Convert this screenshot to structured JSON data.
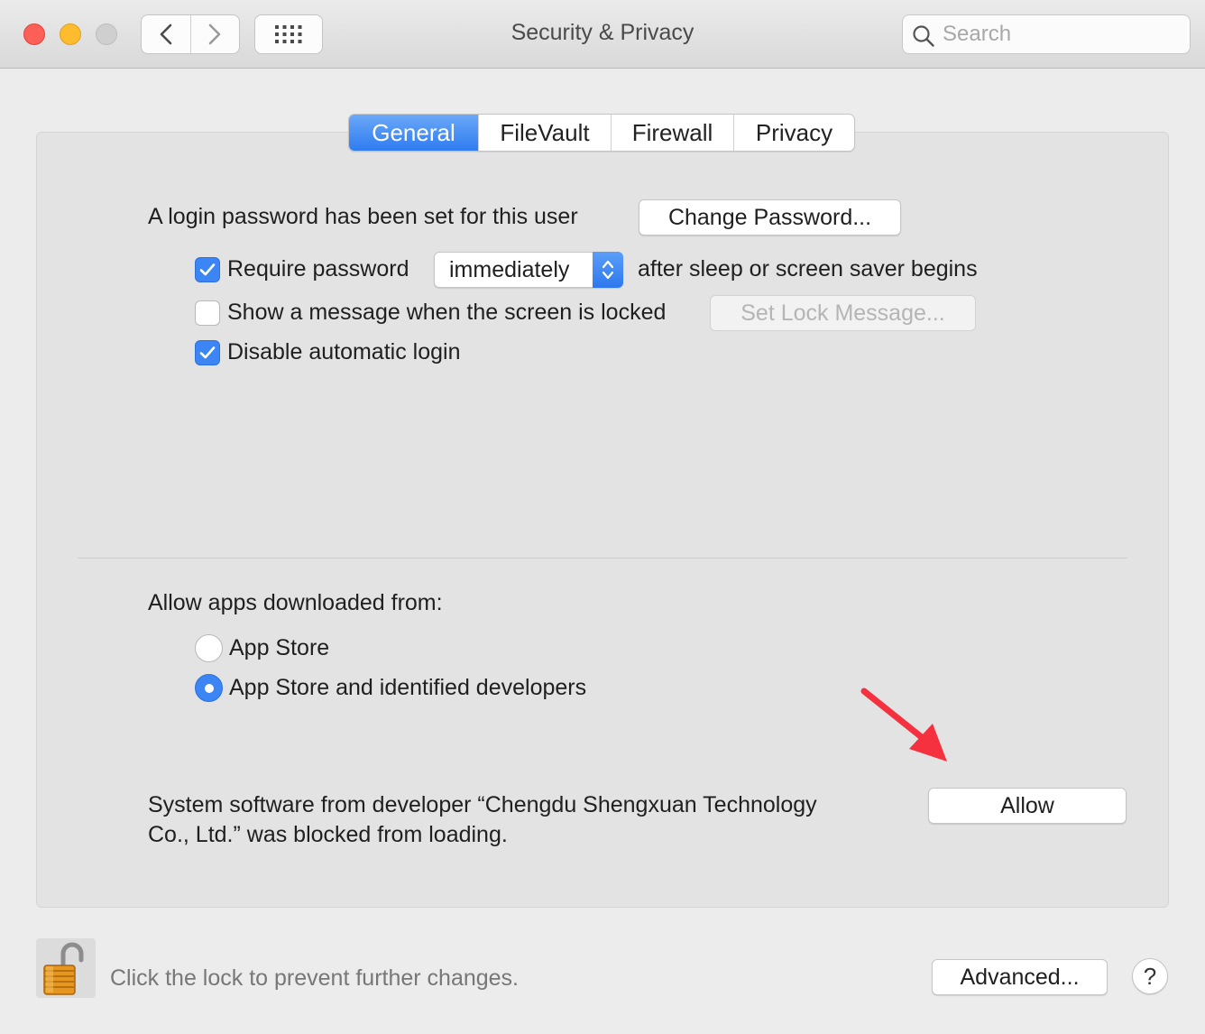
{
  "window": {
    "title": "Security & Privacy",
    "search_placeholder": "Search"
  },
  "tabs": [
    {
      "label": "General",
      "active": true
    },
    {
      "label": "FileVault",
      "active": false
    },
    {
      "label": "Firewall",
      "active": false
    },
    {
      "label": "Privacy",
      "active": false
    }
  ],
  "general": {
    "login_password_text": "A login password has been set for this user",
    "change_password_label": "Change Password...",
    "require_password": {
      "label": "Require password",
      "checked": true
    },
    "require_password_delay": "immediately",
    "after_sleep_text": "after sleep or screen saver begins",
    "show_message": {
      "label": "Show a message when the screen is locked",
      "checked": false
    },
    "set_lock_message_label": "Set Lock Message...",
    "disable_auto_login": {
      "label": "Disable automatic login",
      "checked": true
    },
    "allow_apps_heading": "Allow apps downloaded from:",
    "radio_app_store": {
      "label": "App Store",
      "selected": false
    },
    "radio_app_store_identified": {
      "label": "App Store and identified developers",
      "selected": true
    },
    "blocked_line1": "System software from developer “Chengdu Shengxuan Technology",
    "blocked_line2": "Co., Ltd.” was blocked from loading.",
    "allow_label": "Allow"
  },
  "footer": {
    "lock_text": "Click the lock to prevent further changes.",
    "advanced_label": "Advanced...",
    "help_label": "?"
  },
  "colors": {
    "accent": "#3b85f5",
    "annotation_arrow": "#f5303f"
  }
}
